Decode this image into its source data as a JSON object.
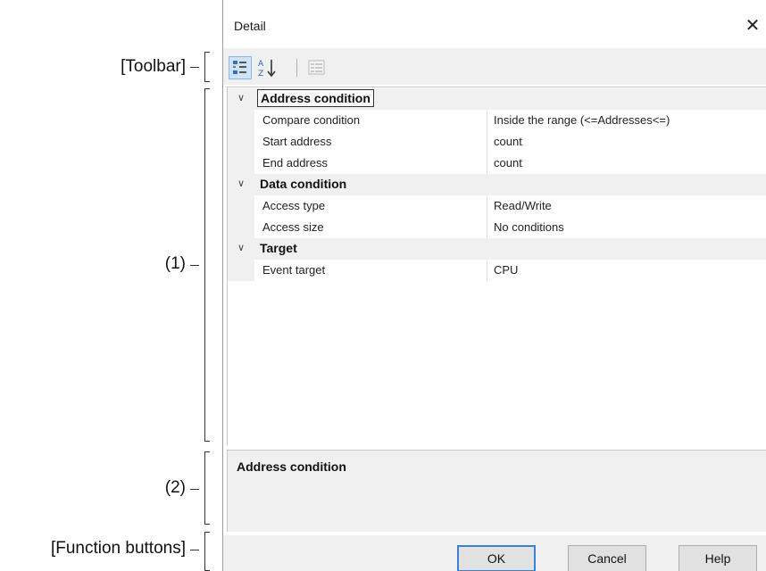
{
  "annotations": {
    "toolbar": "[Toolbar]",
    "area1": "(1)",
    "area2": "(2)",
    "function_buttons": "[Function buttons]"
  },
  "dialog": {
    "title": "Detail",
    "close_glyph": "✕"
  },
  "toolbar": {
    "buttons": [
      {
        "name": "categorized-view-icon",
        "active": true
      },
      {
        "name": "alphabetical-sort-icon",
        "active": false
      },
      {
        "name": "property-pages-icon",
        "active": false
      }
    ]
  },
  "property_grid": {
    "categories": [
      {
        "label": "Address condition",
        "selected": true,
        "properties": [
          {
            "name": "Compare condition",
            "value": "Inside the range (<=Addresses<=)"
          },
          {
            "name": "Start address",
            "value": "count"
          },
          {
            "name": "End address",
            "value": "count"
          }
        ]
      },
      {
        "label": "Data condition",
        "selected": false,
        "properties": [
          {
            "name": "Access type",
            "value": "Read/Write"
          },
          {
            "name": "Access size",
            "value": "No conditions"
          }
        ]
      },
      {
        "label": "Target",
        "selected": false,
        "properties": [
          {
            "name": "Event target",
            "value": "CPU"
          }
        ]
      }
    ],
    "expand_glyph": "∨"
  },
  "description": {
    "title": "Address condition"
  },
  "buttons": {
    "ok": "OK",
    "cancel": "Cancel",
    "help": "Help"
  },
  "colors": {
    "selected_toolbar": "#cfe3f7",
    "default_button_border": "#3c7fd3",
    "panel_bg": "#f0f0f0"
  }
}
